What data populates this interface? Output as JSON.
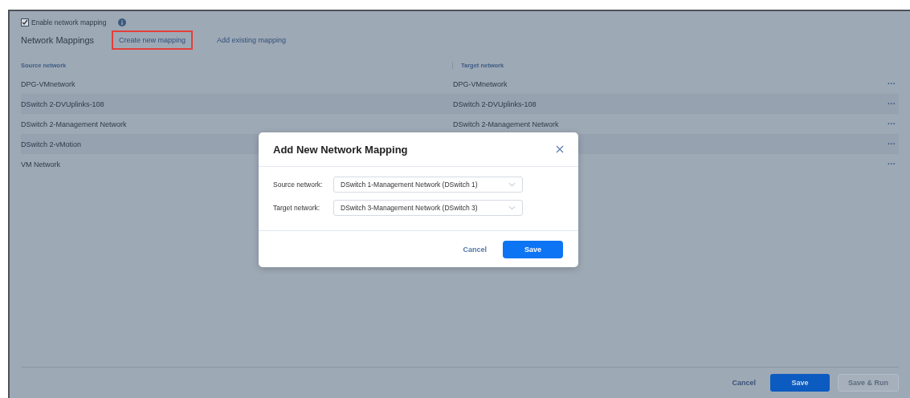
{
  "settings": {
    "enable_mapping": {
      "label": "Enable network mapping",
      "checked": true
    }
  },
  "toolbar": {
    "title": "Network Mappings",
    "actions": [
      {
        "label": "Create new mapping",
        "highlighted": true
      },
      {
        "label": "Add existing mapping",
        "highlighted": false
      }
    ]
  },
  "table": {
    "columns": [
      "Source network",
      "Target network"
    ],
    "rows": [
      {
        "source": "DPG-VMnetwork",
        "target": "DPG-VMnetwork",
        "menu": "···"
      },
      {
        "source": "DSwitch 2-DVUplinks-108",
        "target": "DSwitch 2-DVUplinks-108",
        "menu": "···"
      },
      {
        "source": "DSwitch 2-Management Network",
        "target": "DSwitch 2-Management Network",
        "menu": "···"
      },
      {
        "source": "DSwitch 2-vMotion",
        "menu": "···"
      },
      {
        "source": "VM Network",
        "menu": "···"
      }
    ]
  },
  "footer": {
    "buttons": [
      {
        "label": "Cancel",
        "kind": "link",
        "disabled": false
      },
      {
        "label": "Save",
        "kind": "primary",
        "disabled": false
      },
      {
        "label": "Save & Run",
        "kind": "secondary",
        "disabled": true
      }
    ]
  },
  "dialog": {
    "title": "Add New Network Mapping",
    "fields": [
      {
        "label": "Source network:",
        "value": "DSwitch 1-Management Network (DSwitch 1)"
      },
      {
        "label": "Target network:",
        "value": "DSwitch 3-Management Network (DSwitch 3)"
      }
    ],
    "buttons": [
      {
        "label": "Cancel",
        "kind": "link"
      },
      {
        "label": "Save",
        "kind": "primary"
      }
    ]
  }
}
